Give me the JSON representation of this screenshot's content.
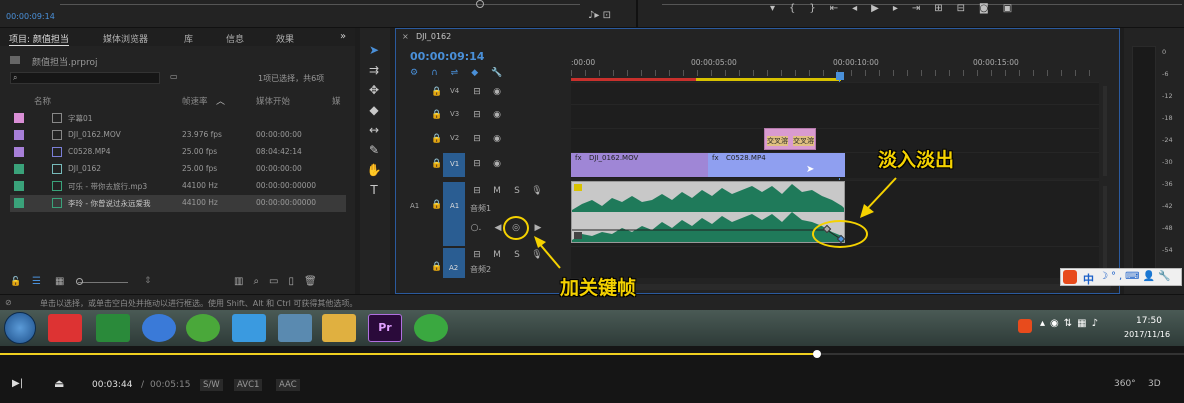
{
  "top": {
    "timecode": "00:00:09:14"
  },
  "project": {
    "tabs": [
      "项目: 颜值担当",
      "媒体浏览器",
      "库",
      "信息",
      "效果"
    ],
    "file": "颜值担当.prproj",
    "selection_info": "1项已选择，共6项",
    "columns": [
      "名称",
      "帧速率",
      "媒体开始",
      "媒"
    ],
    "items": [
      {
        "name": "字幕01",
        "fps": "",
        "start": "",
        "color": "#d98fd6"
      },
      {
        "name": "DJI_0162.MOV",
        "fps": "23.976 fps",
        "start": "00:00:00:00",
        "color": "#a77fd8"
      },
      {
        "name": "C0528.MP4",
        "fps": "25.00 fps",
        "start": "08:04:42:14",
        "color": "#a77fd8"
      },
      {
        "name": "DJI_0162",
        "fps": "25.00 fps",
        "start": "00:00:00:00",
        "color": "#3aa27a"
      },
      {
        "name": "可乐 - 带你去旅行.mp3",
        "fps": "44100 Hz",
        "start": "00:00:00:00000",
        "color": "#3aa27a"
      },
      {
        "name": "李玲 - 你曾说过永远爱我",
        "fps": "44100 Hz",
        "start": "00:00:00:00000",
        "color": "#3aa27a"
      }
    ]
  },
  "timeline": {
    "seq_title": "DJI_0162",
    "timecode": "00:00:09:14",
    "ruler": [
      ":00:00",
      "00:00:05:00",
      "00:00:10:00",
      "00:00:15:00"
    ],
    "tracks": [
      "V4",
      "V3",
      "V2",
      "V1",
      "A1",
      "A2"
    ],
    "a1_label": "A1",
    "a1_name": "音频1",
    "a2_name": "音频2",
    "clip_v1a": "DJI_0162.MOV",
    "clip_v1b": "C0528.MP4",
    "clip_v2": "交叉溶",
    "clip_v2b": "交叉溶",
    "fx": "fx"
  },
  "meter": {
    "levels": [
      "0",
      "-6",
      "-12",
      "-18",
      "-24",
      "-30",
      "-36",
      "-42",
      "-48",
      "-54",
      "dB"
    ]
  },
  "status": {
    "hint": "单击以选择，或单击空白处并拖动以进行框选。使用 Shift、Alt 和 Ctrl 可获得其他选项。"
  },
  "annotations": {
    "fade": "淡入淡出",
    "keyframe": "加关键帧"
  },
  "tray": {
    "ime": "中",
    "time": "17:50",
    "date": "2017/11/16"
  },
  "player": {
    "current": "00:03:44",
    "sep": "/",
    "total": "00:05:15",
    "badges": [
      "S/W",
      "AVC1",
      "AAC"
    ],
    "btn360": "360°",
    "btn3d": "3D",
    "progress": 0.69
  }
}
